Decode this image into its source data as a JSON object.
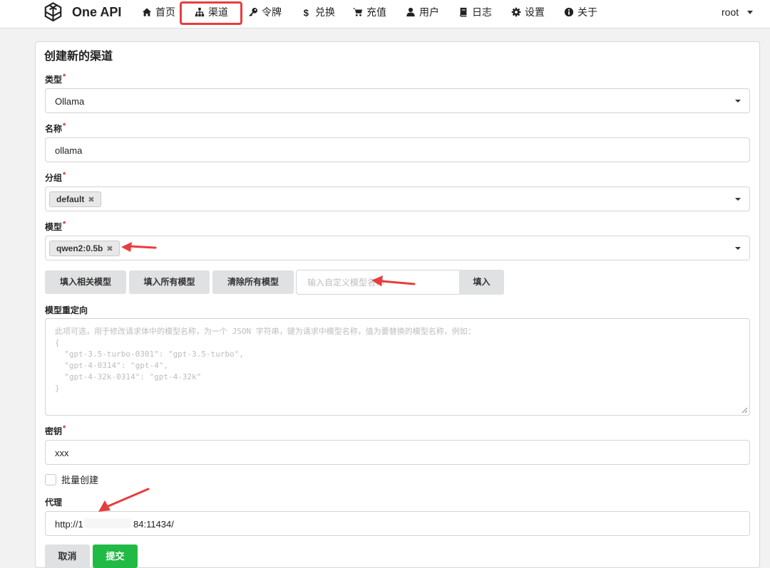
{
  "nav": {
    "brand": "One API",
    "items": [
      {
        "label": "首页",
        "icon": "home-icon"
      },
      {
        "label": "渠道",
        "icon": "sitemap-icon"
      },
      {
        "label": "令牌",
        "icon": "key-icon"
      },
      {
        "label": "兑换",
        "icon": "dollar-icon"
      },
      {
        "label": "充值",
        "icon": "cart-icon"
      },
      {
        "label": "用户",
        "icon": "user-icon"
      },
      {
        "label": "日志",
        "icon": "book-icon"
      },
      {
        "label": "设置",
        "icon": "gear-icon"
      },
      {
        "label": "关于",
        "icon": "info-icon"
      }
    ],
    "active_item": "渠道",
    "user": "root"
  },
  "form": {
    "title": "创建新的渠道",
    "type": {
      "label": "类型",
      "value": "Ollama"
    },
    "name": {
      "label": "名称",
      "value": "ollama"
    },
    "group": {
      "label": "分组",
      "chips": [
        "default"
      ]
    },
    "models": {
      "label": "模型",
      "chips": [
        "qwen2:0.5b"
      ]
    },
    "model_buttons": {
      "fill_related": "填入相关模型",
      "fill_all": "填入所有模型",
      "clear_all": "清除所有模型",
      "custom_placeholder": "输入自定义模型名称",
      "fill": "填入"
    },
    "model_mapping": {
      "label": "模型重定向",
      "placeholder": "此项可选，用于修改请求体中的模型名称，为一个 JSON 字符串，键为请求中模型名称，值为要替换的模型名称，例如：\n{\n  \"gpt-3.5-turbo-0301\": \"gpt-3.5-turbo\",\n  \"gpt-4-0314\": \"gpt-4\",\n  \"gpt-4-32k-0314\": \"gpt-4-32k\"\n}"
    },
    "key": {
      "label": "密钥",
      "value": "xxx"
    },
    "batch": {
      "label": "批量创建"
    },
    "proxy": {
      "label": "代理",
      "value_prefix": "http://1",
      "value_suffix": "84:11434/"
    },
    "cancel": "取消",
    "submit": "提交"
  },
  "colors": {
    "accent": "#21ba45",
    "highlight": "#e63e3e",
    "required": "#db2828"
  }
}
